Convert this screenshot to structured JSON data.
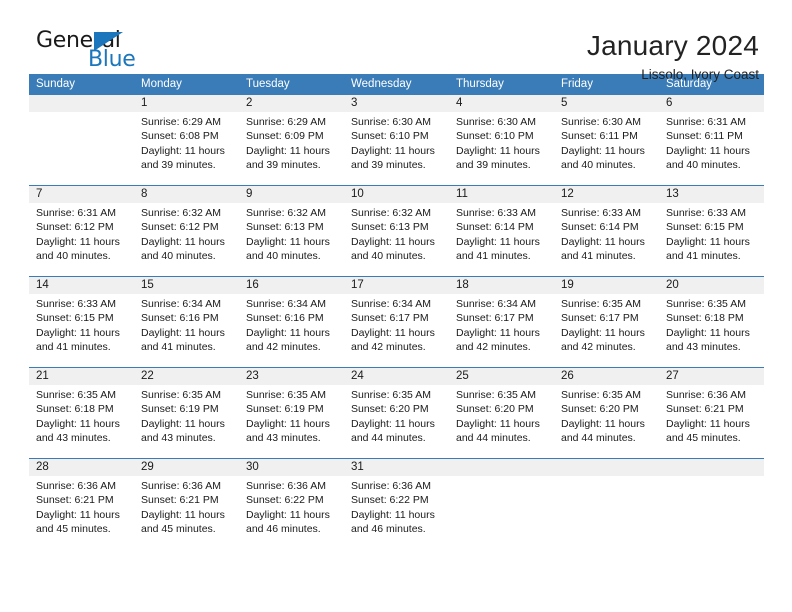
{
  "brand": {
    "name_part1": "General",
    "name_part2": "Blue",
    "triangle_icon": "triangle-icon",
    "color_primary": "#1b76bc",
    "color_text": "#1a1a1a"
  },
  "header": {
    "title": "January 2024",
    "subtitle": "Lissolo, Ivory Coast"
  },
  "calendar": {
    "accent_color": "#3a7cb8",
    "date_band_color": "#f0f0f0",
    "weekdays": [
      "Sunday",
      "Monday",
      "Tuesday",
      "Wednesday",
      "Thursday",
      "Friday",
      "Saturday"
    ],
    "weeks": [
      {
        "days": [
          {
            "date": "",
            "lines": []
          },
          {
            "date": "1",
            "lines": [
              "Sunrise: 6:29 AM",
              "Sunset: 6:08 PM",
              "Daylight: 11 hours",
              "and 39 minutes."
            ]
          },
          {
            "date": "2",
            "lines": [
              "Sunrise: 6:29 AM",
              "Sunset: 6:09 PM",
              "Daylight: 11 hours",
              "and 39 minutes."
            ]
          },
          {
            "date": "3",
            "lines": [
              "Sunrise: 6:30 AM",
              "Sunset: 6:10 PM",
              "Daylight: 11 hours",
              "and 39 minutes."
            ]
          },
          {
            "date": "4",
            "lines": [
              "Sunrise: 6:30 AM",
              "Sunset: 6:10 PM",
              "Daylight: 11 hours",
              "and 39 minutes."
            ]
          },
          {
            "date": "5",
            "lines": [
              "Sunrise: 6:30 AM",
              "Sunset: 6:11 PM",
              "Daylight: 11 hours",
              "and 40 minutes."
            ]
          },
          {
            "date": "6",
            "lines": [
              "Sunrise: 6:31 AM",
              "Sunset: 6:11 PM",
              "Daylight: 11 hours",
              "and 40 minutes."
            ]
          }
        ]
      },
      {
        "days": [
          {
            "date": "7",
            "lines": [
              "Sunrise: 6:31 AM",
              "Sunset: 6:12 PM",
              "Daylight: 11 hours",
              "and 40 minutes."
            ]
          },
          {
            "date": "8",
            "lines": [
              "Sunrise: 6:32 AM",
              "Sunset: 6:12 PM",
              "Daylight: 11 hours",
              "and 40 minutes."
            ]
          },
          {
            "date": "9",
            "lines": [
              "Sunrise: 6:32 AM",
              "Sunset: 6:13 PM",
              "Daylight: 11 hours",
              "and 40 minutes."
            ]
          },
          {
            "date": "10",
            "lines": [
              "Sunrise: 6:32 AM",
              "Sunset: 6:13 PM",
              "Daylight: 11 hours",
              "and 40 minutes."
            ]
          },
          {
            "date": "11",
            "lines": [
              "Sunrise: 6:33 AM",
              "Sunset: 6:14 PM",
              "Daylight: 11 hours",
              "and 41 minutes."
            ]
          },
          {
            "date": "12",
            "lines": [
              "Sunrise: 6:33 AM",
              "Sunset: 6:14 PM",
              "Daylight: 11 hours",
              "and 41 minutes."
            ]
          },
          {
            "date": "13",
            "lines": [
              "Sunrise: 6:33 AM",
              "Sunset: 6:15 PM",
              "Daylight: 11 hours",
              "and 41 minutes."
            ]
          }
        ]
      },
      {
        "days": [
          {
            "date": "14",
            "lines": [
              "Sunrise: 6:33 AM",
              "Sunset: 6:15 PM",
              "Daylight: 11 hours",
              "and 41 minutes."
            ]
          },
          {
            "date": "15",
            "lines": [
              "Sunrise: 6:34 AM",
              "Sunset: 6:16 PM",
              "Daylight: 11 hours",
              "and 41 minutes."
            ]
          },
          {
            "date": "16",
            "lines": [
              "Sunrise: 6:34 AM",
              "Sunset: 6:16 PM",
              "Daylight: 11 hours",
              "and 42 minutes."
            ]
          },
          {
            "date": "17",
            "lines": [
              "Sunrise: 6:34 AM",
              "Sunset: 6:17 PM",
              "Daylight: 11 hours",
              "and 42 minutes."
            ]
          },
          {
            "date": "18",
            "lines": [
              "Sunrise: 6:34 AM",
              "Sunset: 6:17 PM",
              "Daylight: 11 hours",
              "and 42 minutes."
            ]
          },
          {
            "date": "19",
            "lines": [
              "Sunrise: 6:35 AM",
              "Sunset: 6:17 PM",
              "Daylight: 11 hours",
              "and 42 minutes."
            ]
          },
          {
            "date": "20",
            "lines": [
              "Sunrise: 6:35 AM",
              "Sunset: 6:18 PM",
              "Daylight: 11 hours",
              "and 43 minutes."
            ]
          }
        ]
      },
      {
        "days": [
          {
            "date": "21",
            "lines": [
              "Sunrise: 6:35 AM",
              "Sunset: 6:18 PM",
              "Daylight: 11 hours",
              "and 43 minutes."
            ]
          },
          {
            "date": "22",
            "lines": [
              "Sunrise: 6:35 AM",
              "Sunset: 6:19 PM",
              "Daylight: 11 hours",
              "and 43 minutes."
            ]
          },
          {
            "date": "23",
            "lines": [
              "Sunrise: 6:35 AM",
              "Sunset: 6:19 PM",
              "Daylight: 11 hours",
              "and 43 minutes."
            ]
          },
          {
            "date": "24",
            "lines": [
              "Sunrise: 6:35 AM",
              "Sunset: 6:20 PM",
              "Daylight: 11 hours",
              "and 44 minutes."
            ]
          },
          {
            "date": "25",
            "lines": [
              "Sunrise: 6:35 AM",
              "Sunset: 6:20 PM",
              "Daylight: 11 hours",
              "and 44 minutes."
            ]
          },
          {
            "date": "26",
            "lines": [
              "Sunrise: 6:35 AM",
              "Sunset: 6:20 PM",
              "Daylight: 11 hours",
              "and 44 minutes."
            ]
          },
          {
            "date": "27",
            "lines": [
              "Sunrise: 6:36 AM",
              "Sunset: 6:21 PM",
              "Daylight: 11 hours",
              "and 45 minutes."
            ]
          }
        ]
      },
      {
        "days": [
          {
            "date": "28",
            "lines": [
              "Sunrise: 6:36 AM",
              "Sunset: 6:21 PM",
              "Daylight: 11 hours",
              "and 45 minutes."
            ]
          },
          {
            "date": "29",
            "lines": [
              "Sunrise: 6:36 AM",
              "Sunset: 6:21 PM",
              "Daylight: 11 hours",
              "and 45 minutes."
            ]
          },
          {
            "date": "30",
            "lines": [
              "Sunrise: 6:36 AM",
              "Sunset: 6:22 PM",
              "Daylight: 11 hours",
              "and 46 minutes."
            ]
          },
          {
            "date": "31",
            "lines": [
              "Sunrise: 6:36 AM",
              "Sunset: 6:22 PM",
              "Daylight: 11 hours",
              "and 46 minutes."
            ]
          },
          {
            "date": "",
            "lines": []
          },
          {
            "date": "",
            "lines": []
          },
          {
            "date": "",
            "lines": []
          }
        ]
      }
    ]
  }
}
